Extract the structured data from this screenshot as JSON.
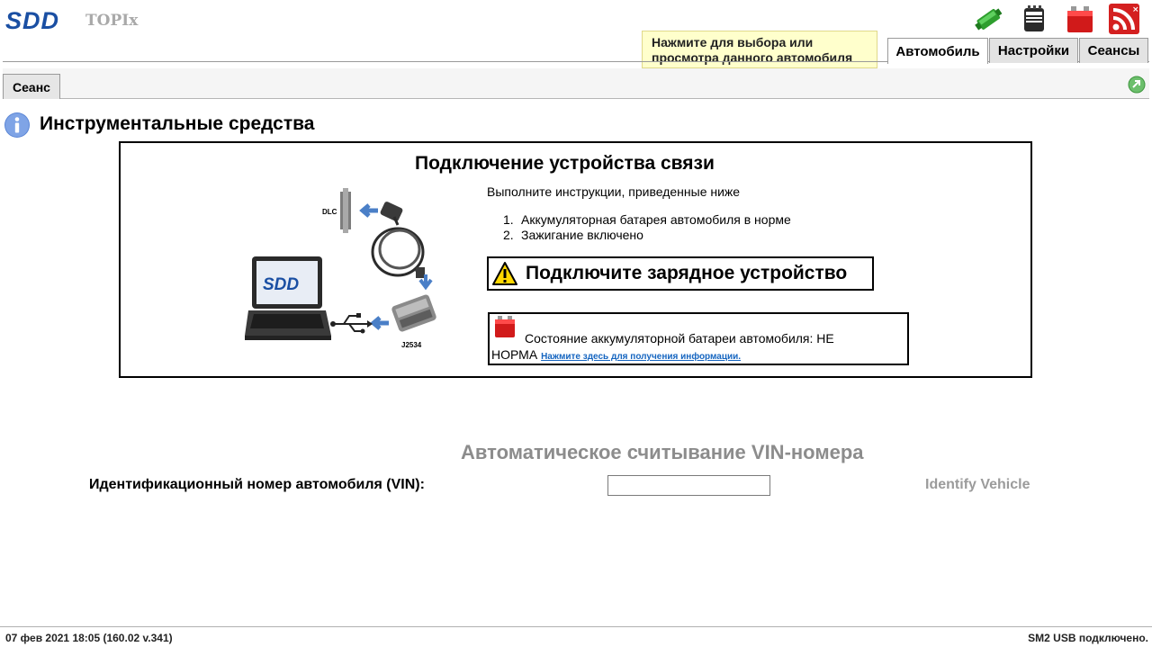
{
  "header": {
    "logo": "SDD",
    "app_name": "TOPIx",
    "tooltip": "Нажмите для выбора или просмотра данного автомобиля",
    "tabs": [
      {
        "label": "Автомобиль",
        "active": true
      },
      {
        "label": "Настройки",
        "active": false
      },
      {
        "label": "Сеансы",
        "active": false
      }
    ],
    "icons": [
      "connection-icon",
      "vci-device-icon",
      "battery-status-icon",
      "rss-feed-icon"
    ]
  },
  "subtabs": [
    {
      "label": "Сеанс"
    }
  ],
  "page": {
    "title": "Инструментальные средства"
  },
  "panel": {
    "title": "Подключение устройства связи",
    "intro": "Выполните инструкции, приведенные ниже",
    "steps": [
      {
        "num": "1.",
        "text": "Аккумуляторная батарея автомобиля в норме"
      },
      {
        "num": "2.",
        "text": "Зажигание включено"
      }
    ],
    "warning": "Подключите зарядное устройство",
    "battery_status": "Состояние аккумуляторной батареи автомобиля:  НЕ",
    "battery_status_2": "НОРМА",
    "info_link": "Нажмите здесь для получения информации.",
    "diagram": {
      "dlc_label": "DLC",
      "j2534_label": "J2534",
      "laptop_logo": "SDD"
    }
  },
  "vin": {
    "heading": "Автоматическое считывание VIN-номера",
    "label": "Идентификационный номер автомобиля (VIN):",
    "value": "",
    "identify_label": "Identify Vehicle"
  },
  "footer": {
    "left": "07 фев 2021 18:05 (160.02 v.341)",
    "right": "SM2 USB подключено."
  },
  "colors": {
    "brand": "#1a4fa3",
    "tooltip_bg": "#ffffcc",
    "disabled_text": "#9b9b9b",
    "link": "#1565c0"
  }
}
